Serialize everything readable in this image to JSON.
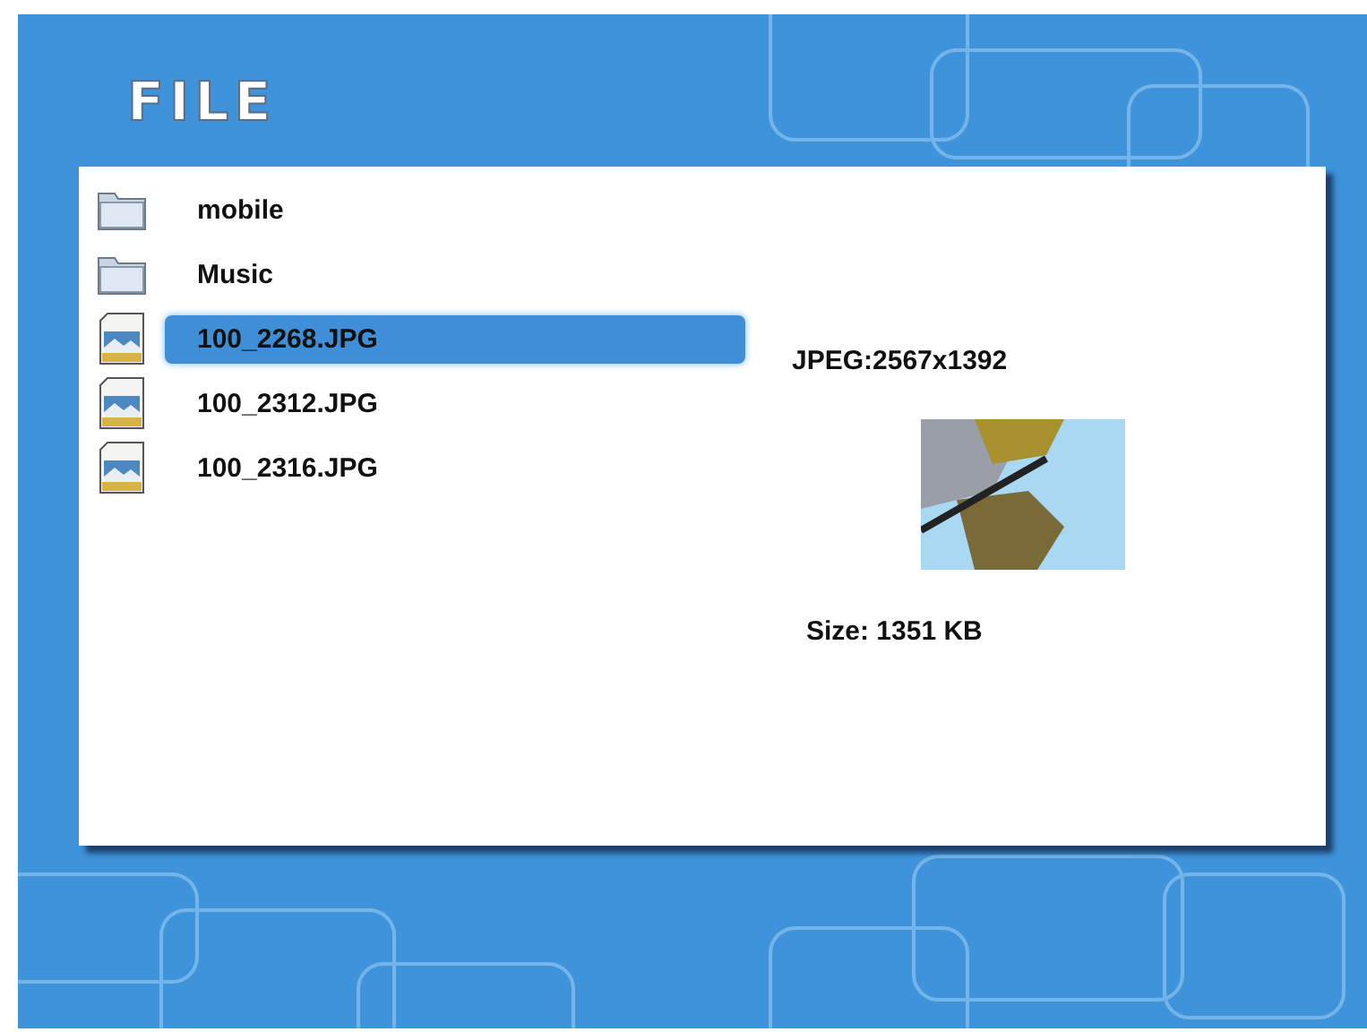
{
  "title": "FILE",
  "items": [
    {
      "kind": "folder",
      "name": "mobile",
      "selected": false
    },
    {
      "kind": "folder",
      "name": "Music",
      "selected": false
    },
    {
      "kind": "image",
      "name": "100_2268.JPG",
      "selected": true
    },
    {
      "kind": "image",
      "name": "100_2312.JPG",
      "selected": false
    },
    {
      "kind": "image",
      "name": "100_2316.JPG",
      "selected": false
    }
  ],
  "preview": {
    "format": "JPEG:2567x1392",
    "size": "Size: 1351 KB"
  }
}
